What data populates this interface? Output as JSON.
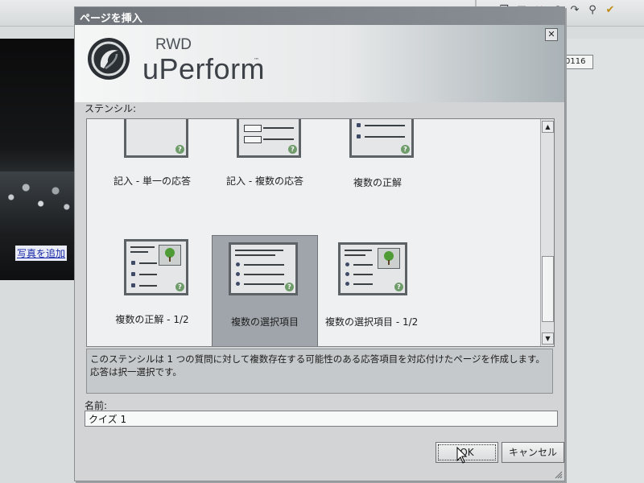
{
  "dialog": {
    "title": "ページを挿入",
    "close_glyph": "✕",
    "brand_small": "RWD",
    "brand_main": "uPerform",
    "brand_tm": "™",
    "section_label": "ステンシル:",
    "stencils": [
      {
        "label": "記入 - 単一の応答",
        "selected": false
      },
      {
        "label": "記入 - 複数の応答",
        "selected": false
      },
      {
        "label": "複数の正解",
        "selected": false
      },
      {
        "label": "複数の正解 - 1/2",
        "selected": false
      },
      {
        "label": "複数の選択項目",
        "selected": true
      },
      {
        "label": "複数の選択項目 - 1/2",
        "selected": false
      }
    ],
    "description": "このステンシルは 1 つの質問に対して複数存在する可能性のある応答項目を対応付けたページを作成します。応答は択一選択です。",
    "name_label": "名前:",
    "name_value": "クイズ 1",
    "ok_label": "OK",
    "cancel_label": "キャンセル"
  },
  "background": {
    "link_text": "写真を追加",
    "id_box": "0116"
  },
  "colors": {
    "title_bar": "#7a8086",
    "selection": "#9fa5ab",
    "help_icon": "#6f9c6a",
    "tree_icon": "#4f9b35"
  }
}
